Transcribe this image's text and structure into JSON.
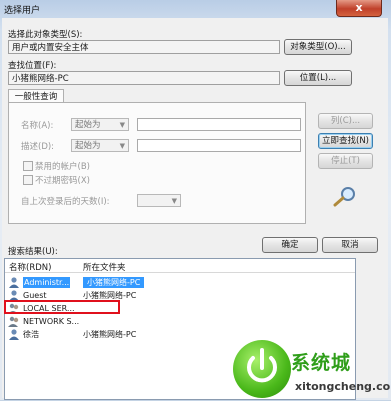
{
  "window": {
    "title": "选择用户",
    "close_glyph": "x"
  },
  "object_type": {
    "label": "选择此对象类型(S):",
    "value": "用户或内置安全主体",
    "button": "对象类型(O)..."
  },
  "location": {
    "label": "查找位置(F):",
    "value": "小猪熊网络-PC",
    "button": "位置(L)..."
  },
  "general_query": {
    "tab_label": "一般性查询",
    "name_label": "名称(A):",
    "name_mode": "起始为",
    "desc_label": "描述(D):",
    "desc_mode": "起始为",
    "disabled_accounts": "禁用的帐户(B)",
    "non_expiring": "不过期密码(X)",
    "days_since_logon": "自上次登录后的天数(I):"
  },
  "buttons": {
    "columns": "列(C)...",
    "find_now": "立即查找(N)",
    "stop": "停止(T)",
    "ok": "确定",
    "cancel": "取消"
  },
  "search_results": {
    "label": "搜索结果(U):",
    "columns": [
      "名称(RDN)",
      "所在文件夹"
    ],
    "rows": [
      {
        "name": "Administr...",
        "folder": "小猪熊网络-PC",
        "selected": true
      },
      {
        "name": "Guest",
        "folder": "小猪熊网络-PC",
        "selected": false
      },
      {
        "name": "LOCAL SER...",
        "folder": "",
        "selected": false
      },
      {
        "name": "NETWORK S...",
        "folder": "",
        "selected": false
      },
      {
        "name": "徐浩",
        "folder": "小猪熊网络-PC",
        "selected": false
      }
    ]
  },
  "watermark": {
    "text": "系统城",
    "url": "xitongcheng.com"
  },
  "colors": {
    "selection": "#3399ff",
    "highlight_box": "#e0101c",
    "watermark": "#2f9e1a"
  }
}
